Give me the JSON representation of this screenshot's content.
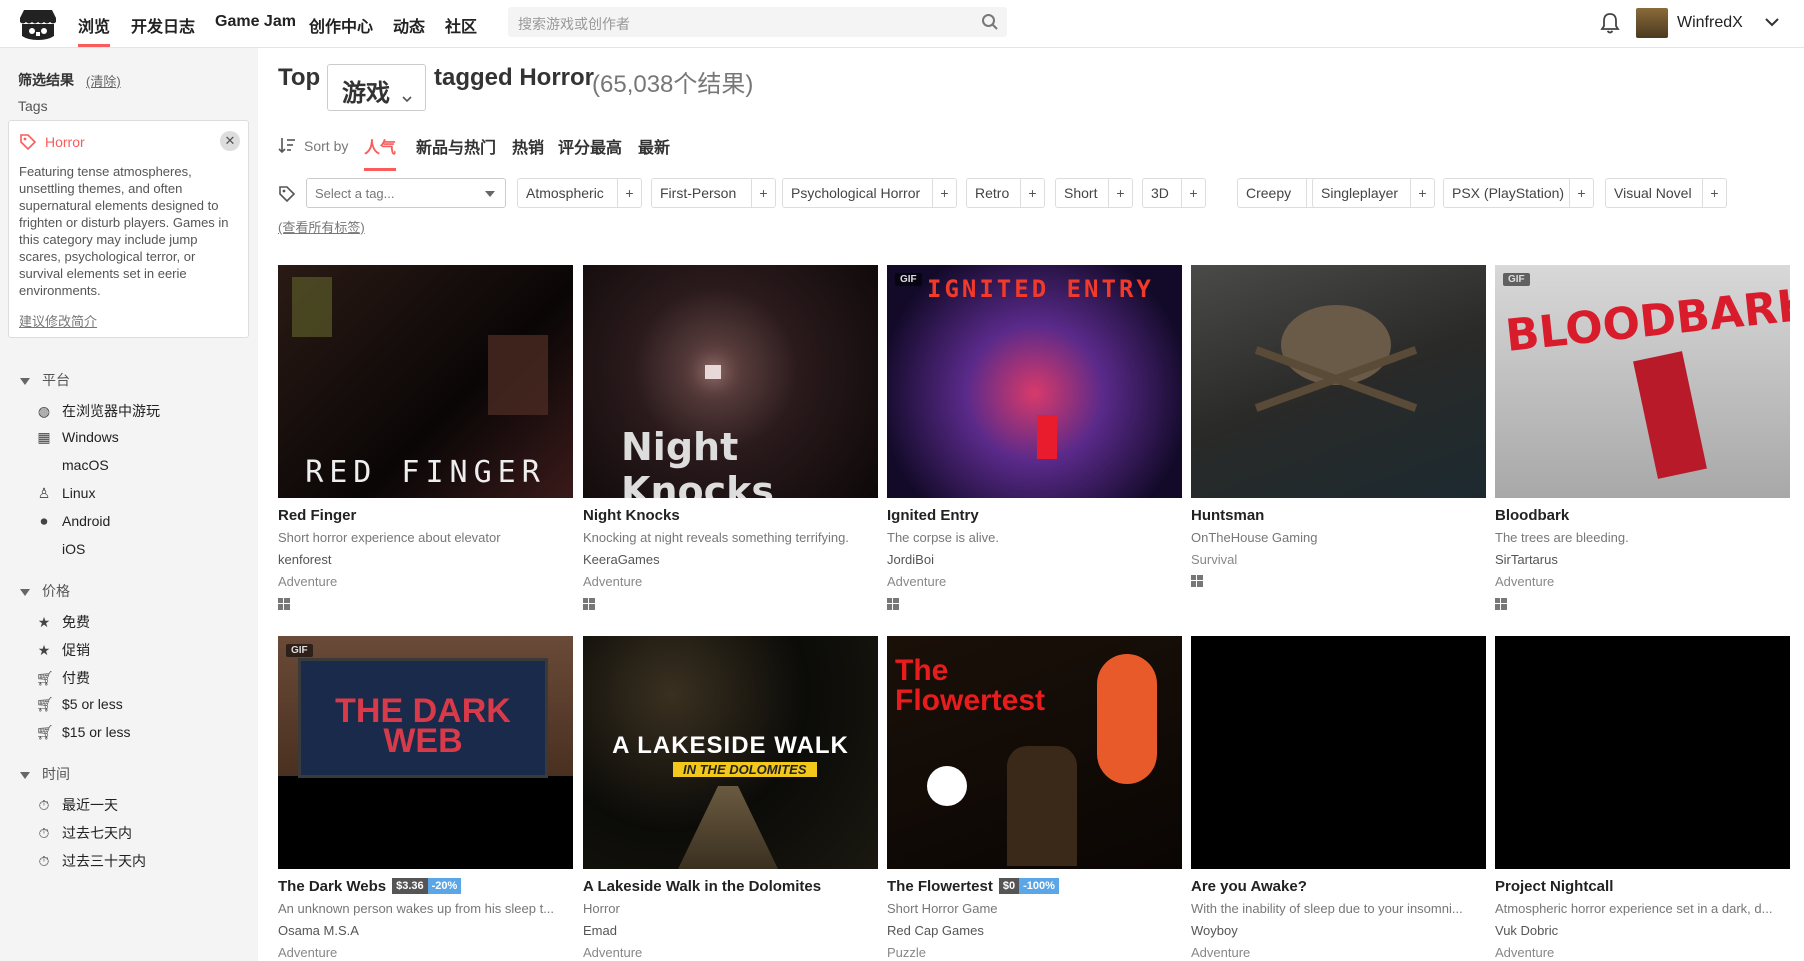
{
  "nav": {
    "items": [
      "浏览",
      "开发日志",
      "Game Jam",
      "创作中心",
      "动态",
      "社区"
    ],
    "search_placeholder": "搜索游戏或创作者",
    "username": "WinfredX"
  },
  "sidebar": {
    "filter_title": "筛选结果",
    "clear": "(清除)",
    "tags_label": "Tags",
    "tag": {
      "name": "Horror",
      "description": "Featuring tense atmospheres, unsettling themes, and often supernatural elements designed to frighten or disturb players. Games in this category may include jump scares, psychological terror, or survival elements set in eerie environments.",
      "suggest": "建议修改简介"
    },
    "platform": {
      "title": "平台",
      "items": [
        {
          "label": "在浏览器中游玩",
          "icon": "globe-icon"
        },
        {
          "label": "Windows",
          "icon": "windows-icon"
        },
        {
          "label": "macOS",
          "icon": "apple-icon"
        },
        {
          "label": "Linux",
          "icon": "linux-icon"
        },
        {
          "label": "Android",
          "icon": "android-icon"
        },
        {
          "label": "iOS",
          "icon": "apple-icon"
        }
      ]
    },
    "price": {
      "title": "价格",
      "items": [
        {
          "label": "免费",
          "icon": "star-icon"
        },
        {
          "label": "促销",
          "icon": "star-icon"
        },
        {
          "label": "付费",
          "icon": "cart-icon"
        },
        {
          "label": "$5 or less",
          "icon": "cart-icon"
        },
        {
          "label": "$15 or less",
          "icon": "cart-icon"
        }
      ]
    },
    "time": {
      "title": "时间",
      "items": [
        {
          "label": "最近一天",
          "icon": "clock-icon"
        },
        {
          "label": "过去七天内",
          "icon": "clock-icon"
        },
        {
          "label": "过去三十天内",
          "icon": "clock-icon"
        }
      ]
    }
  },
  "header": {
    "top": "Top",
    "type": "游戏",
    "tagged": "tagged Horror",
    "count": "(65,038个结果)"
  },
  "sort": {
    "label": "Sort by",
    "options": [
      "人气",
      "新品与热门",
      "热销",
      "评分最高",
      "最新"
    ]
  },
  "tagbar": {
    "placeholder": "Select a tag...",
    "chips": [
      "Atmospheric",
      "First-Person",
      "Psychological Horror",
      "Retro",
      "Short",
      "3D",
      "Creepy",
      "Singleplayer",
      "PSX (PlayStation)",
      "Visual Novel"
    ],
    "plus": "+",
    "all_tags": "(查看所有标签)"
  },
  "games": [
    {
      "title": "Red Finger",
      "desc": "Short horror experience about elevator",
      "author": "kenforest",
      "genre": "Adventure",
      "gif": "",
      "thumb_text": "RED FINGER",
      "bg": "#1a0e0e"
    },
    {
      "title": "Night Knocks",
      "desc": "Knocking at night reveals something terrifying.",
      "author": "KeeraGames",
      "genre": "Adventure",
      "gif": "",
      "thumb_text": "Night Knocks",
      "bg": "#1a1112"
    },
    {
      "title": "Ignited Entry",
      "desc": "The corpse is alive.",
      "author": "JordiBoi",
      "genre": "Adventure",
      "gif": "GIF",
      "thumb_text": "IGNITED ENTRY",
      "bg": "#120a28"
    },
    {
      "title": "Huntsman",
      "desc": "OnTheHouse Gaming",
      "author": "Survival",
      "genre": "",
      "gif": "",
      "thumb_text": "",
      "bg": "#2a2a2a"
    },
    {
      "title": "Bloodbark",
      "desc": "The trees are bleeding.",
      "author": "SirTartarus",
      "genre": "Adventure",
      "gif": "GIF",
      "thumb_text": "BLOODBARK",
      "bg": "#bcbcbc"
    },
    {
      "title": "The Dark Webs",
      "desc": "An unknown person wakes up from his sleep t...",
      "author": "Osama M.S.A",
      "genre": "Adventure",
      "gif": "GIF",
      "thumb_text": "THE DARK WEB",
      "bg": "#5a3a28",
      "price": "$3.36",
      "discount": "-20%"
    },
    {
      "title": "A Lakeside Walk in the Dolomites",
      "desc": "Horror",
      "author": "Emad",
      "genre": "Adventure",
      "gif": "",
      "thumb_text": "A LAKESIDE WALK",
      "thumb_sub": "IN THE DOLOMITES",
      "bg": "#0b0b08"
    },
    {
      "title": "The Flowertest",
      "desc": "Short Horror Game",
      "author": "Red Cap Games",
      "genre": "Puzzle",
      "gif": "",
      "thumb_text": "The Flowertest",
      "bg": "#140d08",
      "price": "$0",
      "discount": "-100%"
    },
    {
      "title": "Are you Awake?",
      "desc": "With the inability of sleep due to your insomni...",
      "author": "Woyboy",
      "genre": "Adventure",
      "gif": "",
      "thumb_text": "",
      "bg": "#000"
    },
    {
      "title": "Project Nightcall",
      "desc": "Atmospheric horror experience set in a dark, d...",
      "author": "Vuk Dobric",
      "genre": "Adventure",
      "gif": "",
      "thumb_text": "",
      "bg": "#000"
    }
  ],
  "colors": {
    "accent": "#fa5c5c",
    "sidebar_bg": "#f4f4f4",
    "discount": "#5aa6e6"
  }
}
